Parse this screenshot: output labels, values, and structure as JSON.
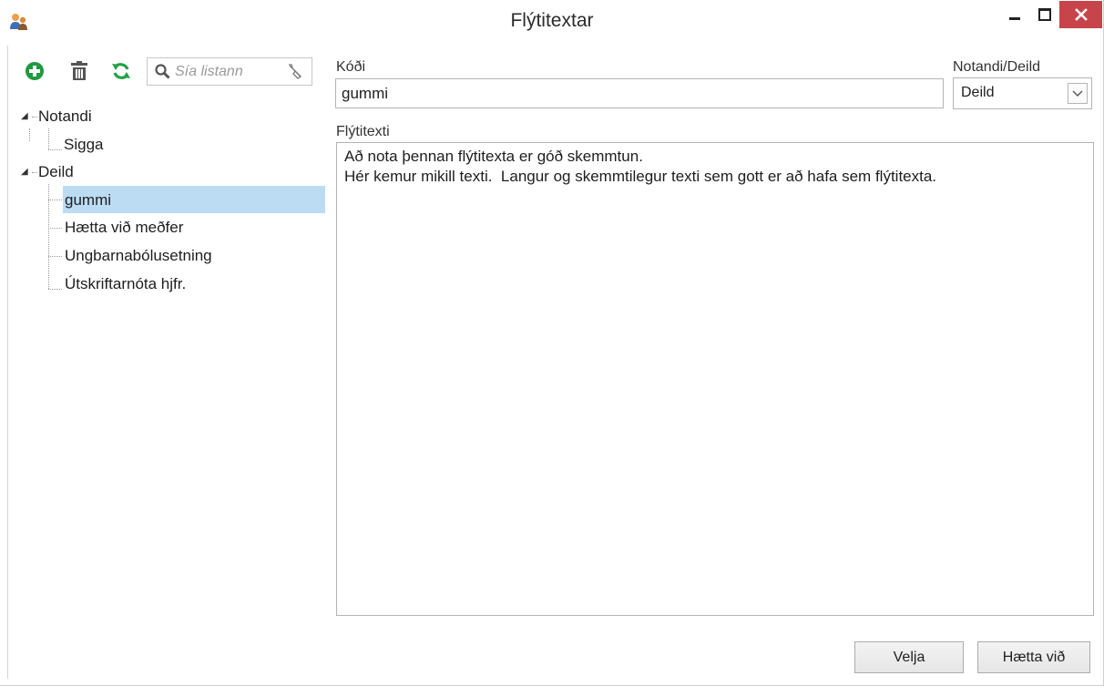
{
  "window": {
    "title": "Flýtitextar",
    "icon": "users-icon"
  },
  "toolbar": {
    "add_icon": "plus-circle-icon",
    "delete_icon": "trash-icon",
    "refresh_icon": "refresh-icon",
    "search_placeholder": "Sía listann",
    "colors": {
      "add": "#1f9a3f",
      "refresh": "#22a146",
      "delete": "#555555"
    }
  },
  "tree": {
    "groups": [
      {
        "label": "Notandi",
        "expanded": true,
        "children": [
          "Sigga"
        ]
      },
      {
        "label": "Deild",
        "expanded": true,
        "children": [
          "gummi",
          "Hætta við meðfer",
          "Ungbarnabólusetning",
          "Útskriftarnóta hjfr."
        ]
      }
    ],
    "selected": "gummi",
    "selection_color": "#bcdcf4"
  },
  "form": {
    "code_label": "Kóði",
    "code_value": "gummi",
    "owner_label": "Notandi/Deild",
    "owner_value": "Deild",
    "text_label": "Flýtitexti",
    "text_lines": [
      "Að nota þennan flýtitexta er góð skemmtun.",
      "Hér kemur mikill texti.  Langur og skemmtilegur texti sem gott er að hafa sem flýtitexta."
    ]
  },
  "buttons": {
    "select": "Velja",
    "cancel": "Hætta við"
  },
  "close_color": "#c7444a"
}
